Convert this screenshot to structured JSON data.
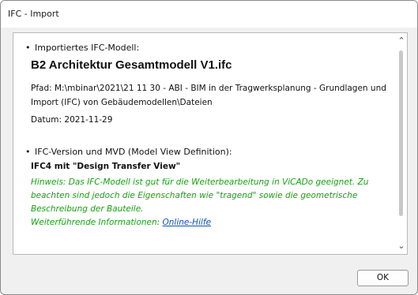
{
  "window": {
    "title": "IFC - Import"
  },
  "model": {
    "label": "Importiertes IFC-Modell:",
    "name": "B2 Architektur Gesamtmodell V1.ifc",
    "path": "Pfad: M:\\mbinar\\2021\\21 11 30 - ABI - BIM in der Tragwerksplanung - Grundlagen und Import (IFC) von Gebäudemodellen\\Dateien",
    "date": "Datum: 2021-11-29"
  },
  "version": {
    "label": "IFC-Version und MVD (Model View Definition):",
    "value": "IFC4 mit \"Design Transfer View\"",
    "hint": "Hinweis: Das IFC-Modell ist gut für die Weiterbearbeitung in ViCADo geeignet. Zu beachten sind jedoch die Eigenschaften wie \"tragend\" sowie die geometrische Beschreibung der Bauteile.",
    "more_prefix": "Weiterführende Informationen:",
    "link_text": "Online-Hilfe"
  },
  "buttons": {
    "ok": "OK"
  },
  "icons": {
    "scroll_up": "chevron-up-icon",
    "scroll_down": "chevron-down-icon"
  }
}
